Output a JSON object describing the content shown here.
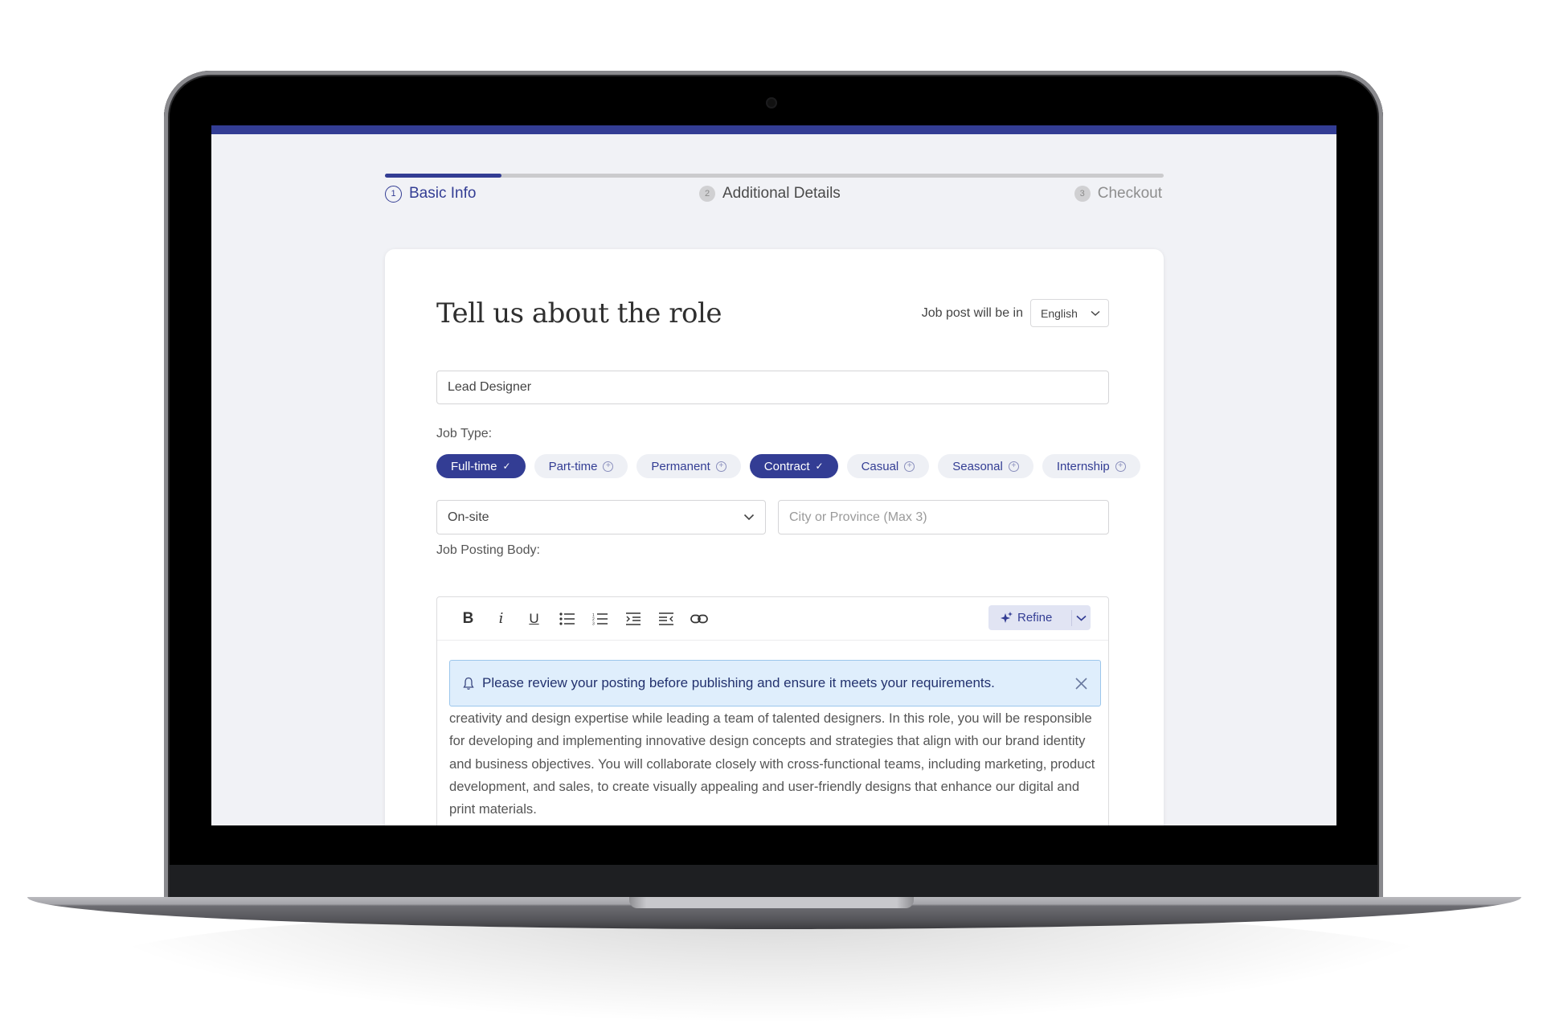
{
  "stepper": {
    "progress": 0.15,
    "steps": [
      {
        "number": "1",
        "label": "Basic Info",
        "state": "active"
      },
      {
        "number": "2",
        "label": "Additional Details",
        "state": "inactive"
      },
      {
        "number": "3",
        "label": "Checkout",
        "state": "inactive"
      }
    ]
  },
  "form": {
    "title": "Tell us about the role",
    "language_label": "Job post will be in",
    "language_value": "English",
    "job_title_value": "Lead Designer",
    "job_type_label": "Job Type:",
    "job_types": [
      {
        "label": "Full-time",
        "selected": true
      },
      {
        "label": "Part-time",
        "selected": false
      },
      {
        "label": "Permanent",
        "selected": false
      },
      {
        "label": "Contract",
        "selected": true
      },
      {
        "label": "Casual",
        "selected": false
      },
      {
        "label": "Seasonal",
        "selected": false
      },
      {
        "label": "Internship",
        "selected": false
      }
    ],
    "work_type_value": "On-site",
    "location_placeholder": "City or Province (Max 3)",
    "body_label": "Job Posting Body:"
  },
  "editor": {
    "toolbar": [
      "bold-icon",
      "italic-icon",
      "underline-icon",
      "bullet-list-icon",
      "numbered-list-icon",
      "indent-icon",
      "outdent-icon",
      "link-icon"
    ],
    "refine_label": "Refine",
    "alert_text": "Please review your posting before publishing and ensure it meets your requirements.",
    "body_text": "creativity and design expertise while leading a team of talented designers. In this role, you will be responsible for developing and implementing innovative design concepts and strategies that align with our brand identity and business objectives. You will collaborate closely with cross-functional teams, including marketing, product development, and sales, to create visually appealing and user-friendly designs that enhance our digital and print materials."
  },
  "colors": {
    "accent": "#333d94",
    "alert_bg": "#dfeefc",
    "chip_off_bg": "#eef0f5"
  }
}
